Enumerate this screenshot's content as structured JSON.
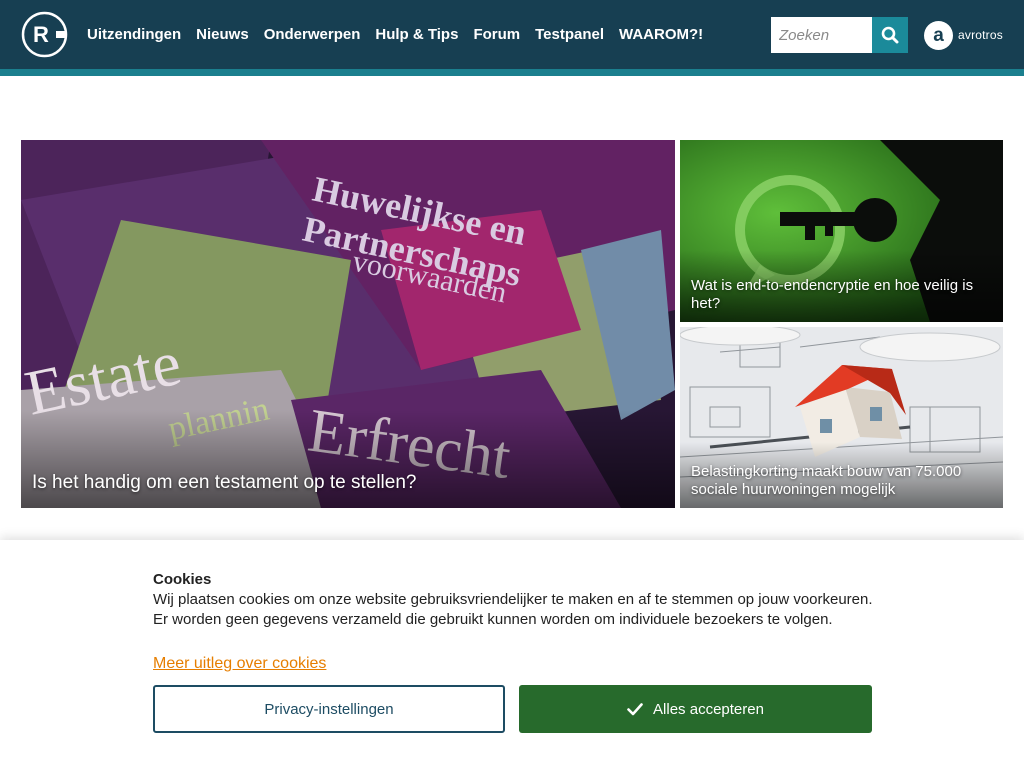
{
  "header": {
    "logo_letter": "R",
    "nav": [
      {
        "label": "Uitzendingen"
      },
      {
        "label": "Nieuws"
      },
      {
        "label": "Onderwerpen"
      },
      {
        "label": "Hulp & Tips"
      },
      {
        "label": "Forum"
      },
      {
        "label": "Testpanel"
      },
      {
        "label": "WAAROM?!"
      }
    ],
    "search": {
      "placeholder": "Zoeken",
      "value": "",
      "icon": "search-icon"
    },
    "broadcaster": {
      "mark": "a",
      "name": "avrotros"
    },
    "colors": {
      "bar": "#173f52",
      "stripe": "#1b7f8e",
      "search_button": "#1b8a9a"
    }
  },
  "featured": {
    "main": {
      "title": "Is het handig om een testament op te stellen?"
    },
    "top": {
      "title": "Wat is end-to-endencryptie en hoe veilig is het?"
    },
    "bottom": {
      "title": "Belastingkorting maakt bouw van 75.000 sociale huurwoningen mogelijk"
    }
  },
  "cookies": {
    "title": "Cookies",
    "text": "Wij plaatsen cookies om onze website gebruiksvriendelijker te maken en af te stemmen op jouw voorkeuren. Er worden geen gegevens verzameld die gebruikt kunnen worden om individuele bezoekers te volgen.",
    "link": "Meer uitleg over cookies",
    "privacy_button": "Privacy-instellingen",
    "accept_button": "Alles accepteren",
    "colors": {
      "link": "#e67e00",
      "accept": "#276a2c",
      "privacy_border": "#1d4c63"
    }
  }
}
